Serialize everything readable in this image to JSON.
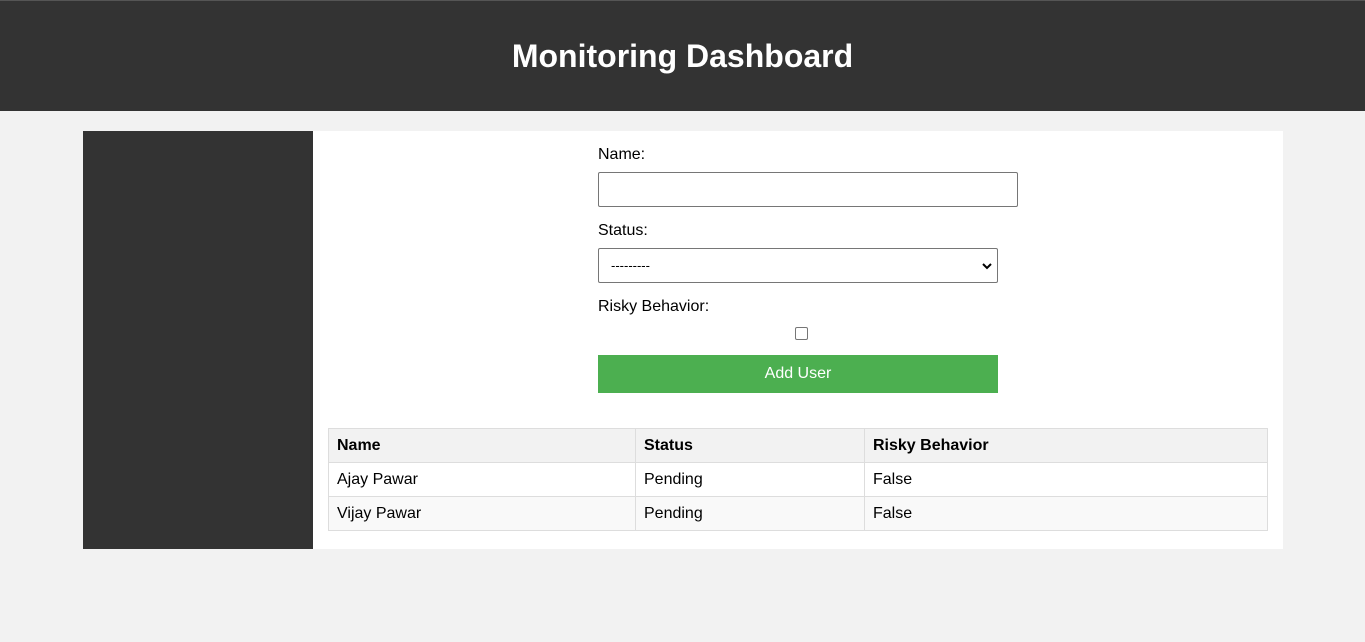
{
  "header": {
    "title": "Monitoring Dashboard"
  },
  "form": {
    "name_label": "Name:",
    "name_value": "",
    "status_label": "Status:",
    "status_selected": "---------",
    "risky_label": "Risky Behavior:",
    "risky_checked": false,
    "submit_label": "Add User"
  },
  "table": {
    "headers": [
      "Name",
      "Status",
      "Risky Behavior"
    ],
    "rows": [
      [
        "Ajay Pawar",
        "Pending",
        "False"
      ],
      [
        "Vijay Pawar",
        "Pending",
        "False"
      ]
    ]
  },
  "colors": {
    "header_bg": "#333333",
    "sidebar_bg": "#333333",
    "button_bg": "#4caf50",
    "page_bg": "#f2f2f2"
  }
}
